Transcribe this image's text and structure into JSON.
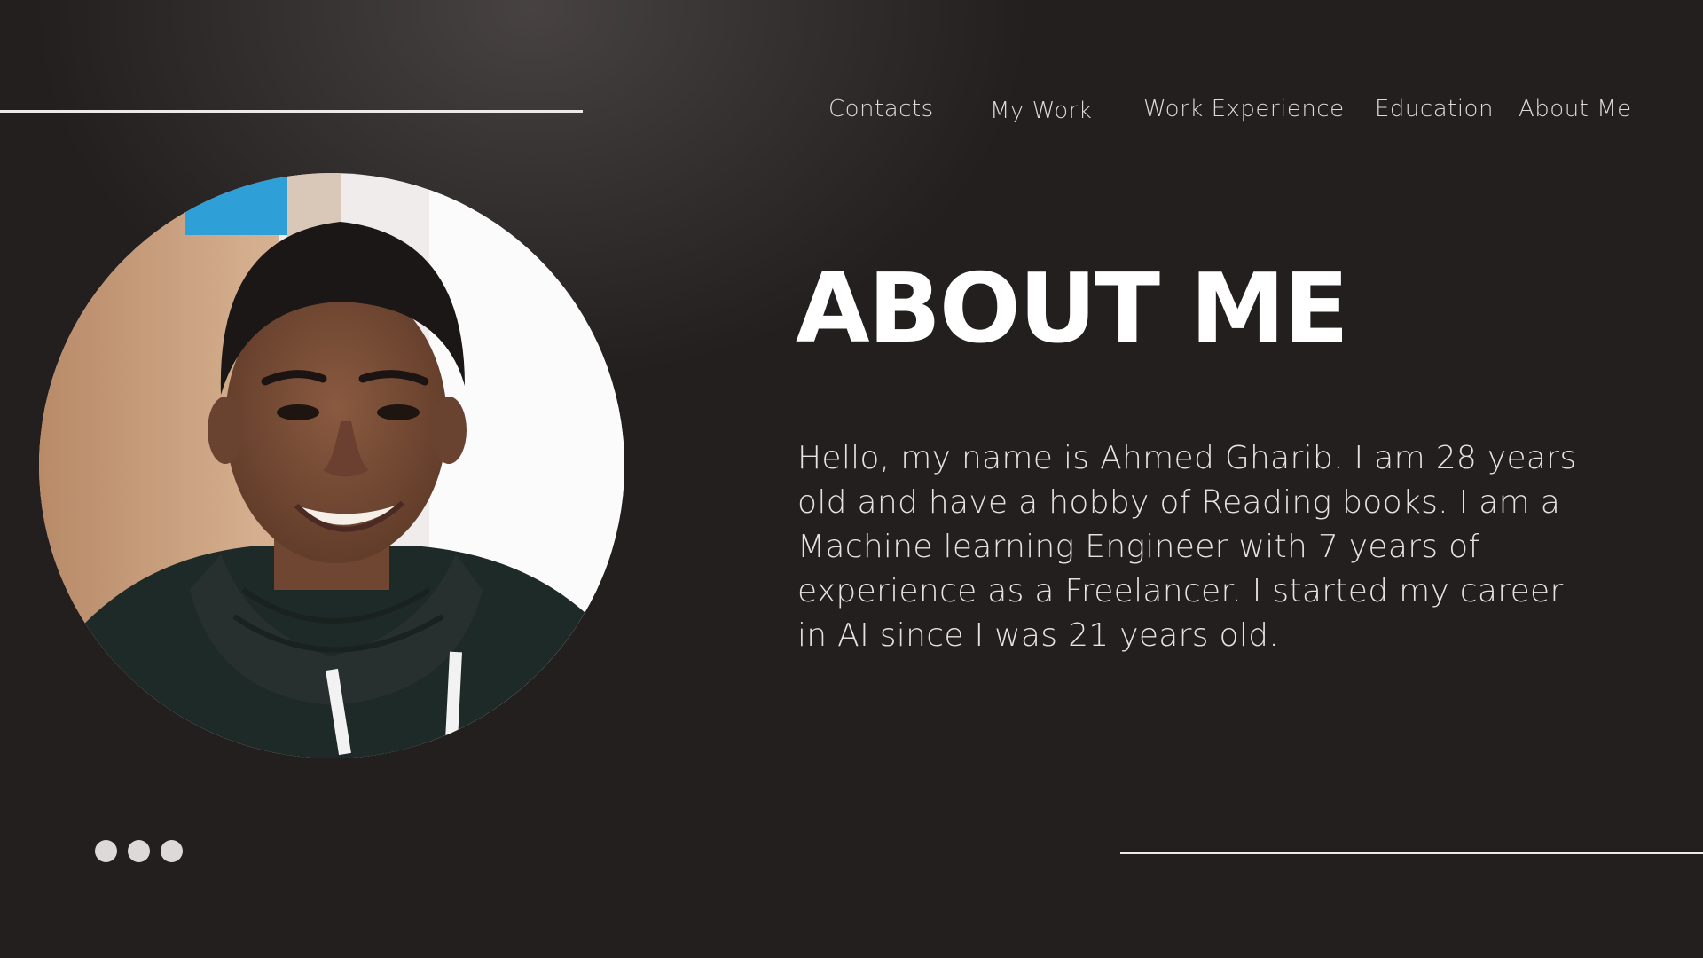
{
  "nav": {
    "items": [
      {
        "label": "Contacts"
      },
      {
        "label": "My Work"
      },
      {
        "label": "Work Experience"
      },
      {
        "label": "Education"
      },
      {
        "label": "About Me"
      }
    ]
  },
  "main": {
    "title": "ABOUT ME",
    "bio": "Hello, my name is Ahmed Gharib. I am 28 years old and have a hobby of Reading books. I am a Machine learning Engineer with 7 years of experience as a Freelancer. I started my career in AI since I was 21 years old."
  },
  "pagination": {
    "dot_count": 3
  },
  "theme": {
    "background": "#231f1f",
    "text": "#ffffff",
    "accent_line": "#ece9e6"
  },
  "icons": {
    "pagination": "dots-icon"
  }
}
